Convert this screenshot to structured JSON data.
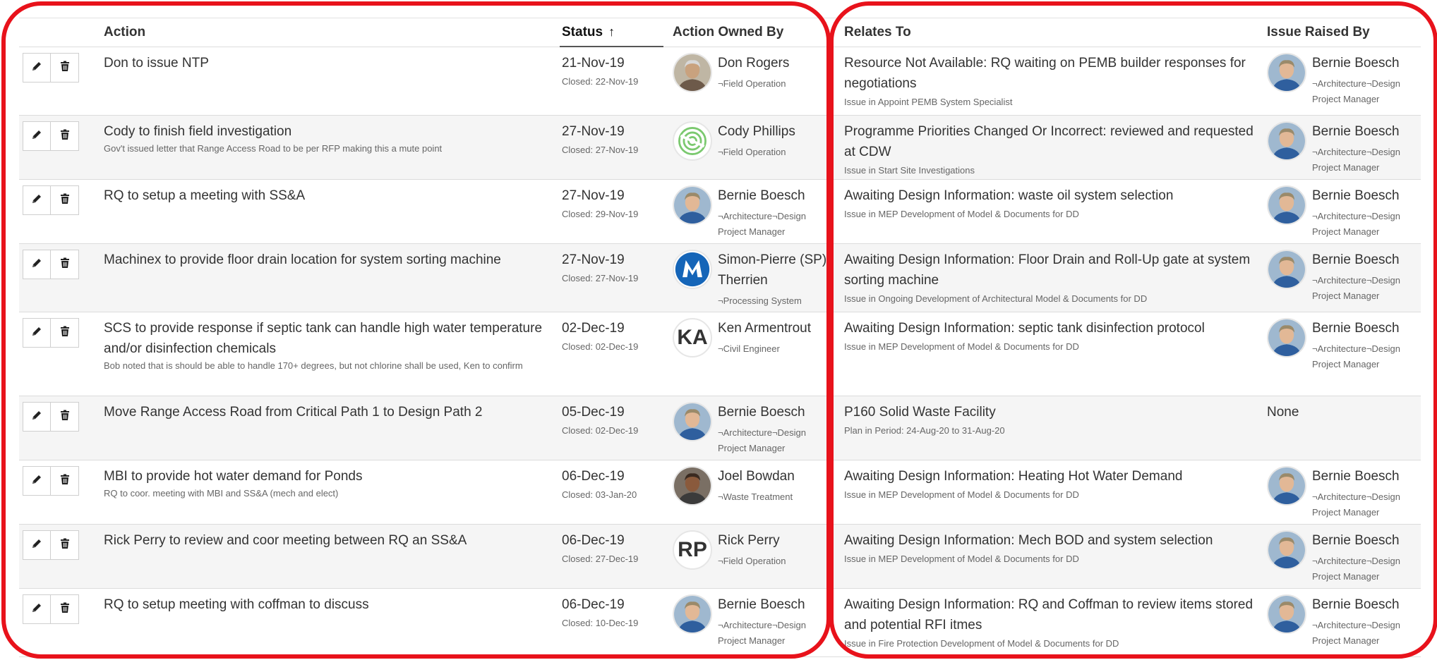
{
  "columns": {
    "action": "Action",
    "status": "Status",
    "owned_by": "Action Owned By",
    "relates_to": "Relates To",
    "raised_by": "Issue Raised By"
  },
  "rows": [
    {
      "action": "Don to issue NTP",
      "action_note": "",
      "date": "21-Nov-19",
      "closed": "Closed: 22-Nov-19",
      "owner": {
        "name": "Don Rogers",
        "dept": "¬Field Operation",
        "role": "",
        "avatar": "photo-older-man"
      },
      "relates": "Resource Not Available: RQ waiting on PEMB builder responses for negotiations",
      "relates_sub": "Issue in Appoint PEMB System Specialist",
      "raiser": {
        "name": "Bernie Boesch",
        "dept": "¬Architecture¬Design",
        "role": "Project Manager"
      }
    },
    {
      "action": "Cody to finish field investigation",
      "action_note": "Gov't issued letter that Range Access Road to be per RFP making this a mute point",
      "date": "27-Nov-19",
      "closed": "Closed: 27-Nov-19",
      "owner": {
        "name": "Cody Phillips",
        "dept": "¬Field Operation",
        "role": "",
        "avatar": "green-logo"
      },
      "relates": "Programme Priorities Changed Or Incorrect: reviewed and requested at CDW",
      "relates_sub": "Issue in Start Site Investigations",
      "raiser": {
        "name": "Bernie Boesch",
        "dept": "¬Architecture¬Design",
        "role": "Project Manager"
      }
    },
    {
      "action": "RQ to setup a meeting with SS&A",
      "action_note": "",
      "date": "27-Nov-19",
      "closed": "Closed: 29-Nov-19",
      "owner": {
        "name": "Bernie Boesch",
        "dept": "¬Architecture¬Design",
        "role": "Project Manager",
        "avatar": "photo-bernie"
      },
      "relates": "Awaiting Design Information: waste oil system selection",
      "relates_sub": "Issue in MEP Development of Model & Documents for DD",
      "raiser": {
        "name": "Bernie Boesch",
        "dept": "¬Architecture¬Design",
        "role": "Project Manager"
      }
    },
    {
      "action": "Machinex to provide floor drain location for system sorting machine",
      "action_note": "",
      "date": "27-Nov-19",
      "closed": "Closed: 27-Nov-19",
      "owner": {
        "name": "Simon-Pierre (SP)",
        "name2": "Therrien",
        "dept": "¬Processing System",
        "role": "",
        "avatar": "m-logo"
      },
      "relates": "Awaiting Design Information: Floor Drain and Roll-Up gate at system sorting machine",
      "relates_sub": "Issue in Ongoing Development of Architectural Model & Documents for DD",
      "raiser": {
        "name": "Bernie Boesch",
        "dept": "¬Architecture¬Design",
        "role": "Project Manager"
      }
    },
    {
      "action": "SCS to provide response if septic tank can handle high water temperature and/or disinfection chemicals",
      "action_note": "Bob noted that is should be able to handle 170+ degrees, but not chlorine shall be used, Ken to confirm",
      "date": "02-Dec-19",
      "closed": "Closed: 02-Dec-19",
      "owner": {
        "name": "Ken Armentrout",
        "dept": "¬Civil Engineer",
        "role": "",
        "avatar": "initials",
        "initials": "KA"
      },
      "relates": "Awaiting Design Information: septic tank disinfection protocol",
      "relates_sub": "Issue in MEP Development of Model & Documents for DD",
      "raiser": {
        "name": "Bernie Boesch",
        "dept": "¬Architecture¬Design",
        "role": "Project Manager"
      }
    },
    {
      "action": "Move Range Access Road from Critical Path 1 to Design Path 2",
      "action_note": "",
      "date": "05-Dec-19",
      "closed": "Closed: 02-Dec-19",
      "owner": {
        "name": "Bernie Boesch",
        "dept": "¬Architecture¬Design",
        "role": "Project Manager",
        "avatar": "photo-bernie"
      },
      "relates": "P160 Solid Waste Facility",
      "relates_sub": "Plan in Period: 24-Aug-20 to 31-Aug-20",
      "raiser": {
        "name": "None",
        "dept": "",
        "role": "",
        "none": true
      }
    },
    {
      "action": "MBI to provide hot water demand for Ponds",
      "action_note": "RQ to coor. meeting with MBI and SS&A (mech and elect)",
      "date": "06-Dec-19",
      "closed": "Closed: 03-Jan-20",
      "owner": {
        "name": "Joel Bowdan",
        "dept": "¬Waste Treatment",
        "role": "",
        "avatar": "photo-joel"
      },
      "relates": "Awaiting Design Information: Heating Hot Water Demand",
      "relates_sub": "Issue in MEP Development of Model & Documents for DD",
      "raiser": {
        "name": "Bernie Boesch",
        "dept": "¬Architecture¬Design",
        "role": "Project Manager"
      }
    },
    {
      "action": "Rick Perry to review and coor meeting between RQ an SS&A",
      "action_note": "",
      "date": "06-Dec-19",
      "closed": "Closed: 27-Dec-19",
      "owner": {
        "name": "Rick Perry",
        "dept": "¬Field Operation",
        "role": "",
        "avatar": "initials",
        "initials": "RP"
      },
      "relates": "Awaiting Design Information: Mech BOD and system selection",
      "relates_sub": "Issue in MEP Development of Model & Documents for DD",
      "raiser": {
        "name": "Bernie Boesch",
        "dept": "¬Architecture¬Design",
        "role": "Project Manager"
      }
    },
    {
      "action": "RQ to setup meeting with coffman to discuss",
      "action_note": "",
      "date": "06-Dec-19",
      "closed": "Closed: 10-Dec-19",
      "owner": {
        "name": "Bernie Boesch",
        "dept": "¬Architecture¬Design",
        "role": "Project Manager",
        "avatar": "photo-bernie"
      },
      "relates": "Awaiting Design Information: RQ and Coffman to review items stored and potential RFI itmes",
      "relates_sub": "Issue in Fire Protection Development of Model & Documents for DD",
      "raiser": {
        "name": "Bernie Boesch",
        "dept": "¬Architecture¬Design",
        "role": "Project Manager"
      }
    }
  ],
  "colors": {
    "highlight": "#e8121b",
    "row_alt": "#f5f5f5"
  }
}
